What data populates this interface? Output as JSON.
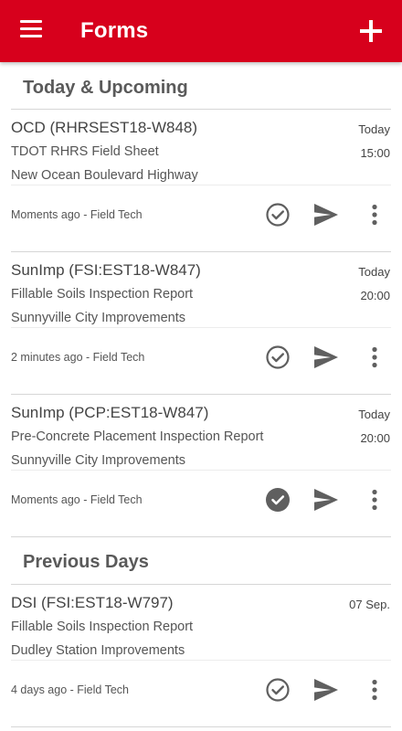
{
  "app": {
    "title": "Forms",
    "accent": "#d7001c",
    "menu_icon": "hamburger-menu-icon",
    "add_icon": "plus-icon"
  },
  "sections": {
    "today": {
      "label": "Today & Upcoming"
    },
    "previous": {
      "label": "Previous Days"
    }
  },
  "cards": [
    {
      "title": "OCD (RHRSEST18-W848)",
      "date": "Today",
      "form": "TDOT RHRS Field Sheet",
      "time": "15:00",
      "project": "New Ocean Boulevard Highway",
      "meta": "Moments ago - Field Tech",
      "checked": false
    },
    {
      "title": "SunImp (FSI:EST18-W847)",
      "date": "Today",
      "form": "Fillable Soils Inspection Report",
      "time": "20:00",
      "project": "Sunnyville City Improvements",
      "meta": "2 minutes ago - Field Tech",
      "checked": false
    },
    {
      "title": "SunImp (PCP:EST18-W847)",
      "date": "Today",
      "form": "Pre-Concrete Placement Inspection Report",
      "time": "20:00",
      "project": "Sunnyville City Improvements",
      "meta": "Moments ago - Field Tech",
      "checked": true
    },
    {
      "title": "DSI (FSI:EST18-W797)",
      "date": "07 Sep.",
      "form": "Fillable Soils Inspection Report",
      "time": "",
      "project": "Dudley Station Improvements",
      "meta": "4 days ago - Field Tech",
      "checked": false
    }
  ]
}
